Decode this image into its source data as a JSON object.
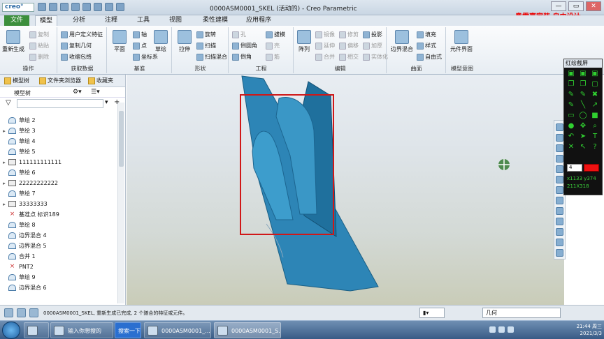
{
  "window": {
    "title": "0000ASM0001_SKEL (活动的) - Creo Parametric",
    "logo": "creo°",
    "controls": [
      "—",
      "▭",
      "✕"
    ],
    "overlay_text": "奥雷嘉家装 自由设计"
  },
  "ribbon_tabs": [
    "文件",
    "模型",
    "分析",
    "注释",
    "工具",
    "视图",
    "柔性建模",
    "应用程序"
  ],
  "ribbon": {
    "groups": {
      "operations": "操作",
      "get_data": "获取数据",
      "datum": "基准",
      "shape": "形状",
      "engineering": "工程",
      "editing": "编辑",
      "surfaces": "曲面",
      "model_intent": "模型意图"
    },
    "operations": {
      "regenerate": "重新生成",
      "copy": "复制",
      "paste": "粘贴",
      "delete": "删除"
    },
    "get_data": {
      "udf": "用户定义特征",
      "copy_geom": "复制几何",
      "shrinkwrap": "收缩包络"
    },
    "datum": {
      "plane": "平面",
      "axis": "轴",
      "point": "点",
      "csys": "坐标系",
      "sketch": "草绘"
    },
    "shape": {
      "extrude": "拉伸",
      "revolve": "旋转",
      "sweep": "扫描",
      "swept_blend": "扫描混合"
    },
    "engineering": {
      "hole": "孔",
      "round": "倒圆角",
      "chamfer": "倒角",
      "draft": "拔模",
      "shell": "壳",
      "rib": "筋"
    },
    "editing": {
      "pattern": "阵列",
      "mirror": "镜像",
      "extend": "延伸",
      "trim": "修剪",
      "offset": "偏移",
      "merge": "合并",
      "intersect": "相交",
      "thicken": "加厚",
      "solidify": "实体化",
      "project": "投影"
    },
    "surfaces": {
      "boundary_blend": "边界混合",
      "fill": "填充",
      "style": "样式",
      "freestyle": "自由式"
    },
    "model_intent": {
      "component_interface": "元件界面"
    }
  },
  "nav": {
    "tabs": [
      "模型树",
      "文件夹浏览器",
      "收藏夹"
    ],
    "tree_header": "模型树",
    "filter_placeholder": "",
    "items": [
      {
        "label": "草绘 2",
        "expandable": false
      },
      {
        "label": "草绘 3",
        "expandable": true
      },
      {
        "label": "草绘 4",
        "expandable": false
      },
      {
        "label": "草绘 5",
        "expandable": false
      },
      {
        "label": "111111111111",
        "expandable": true
      },
      {
        "label": "草绘 6",
        "expandable": false
      },
      {
        "label": "22222222222",
        "expandable": true
      },
      {
        "label": "草绘 7",
        "expandable": false
      },
      {
        "label": "33333333",
        "expandable": true
      },
      {
        "label": "基准点 标识189",
        "expandable": false
      },
      {
        "label": "草绘 8",
        "expandable": false
      },
      {
        "label": "边界混合 4",
        "expandable": false
      },
      {
        "label": "边界混合 5",
        "expandable": false
      },
      {
        "label": "合并 1",
        "expandable": false
      },
      {
        "label": "PNT2",
        "expandable": false
      },
      {
        "label": "草绘 9",
        "expandable": false
      },
      {
        "label": "边界混合 6",
        "expandable": false
      }
    ]
  },
  "palette": {
    "title": "红绘截屏",
    "size_value": "4",
    "coords": "x1133 y374",
    "dims": "211X318"
  },
  "status": {
    "message": "0000ASM0001_SKEL, 重新生成已完成, 2 个随合的特征或元件。",
    "filter_value": "几何"
  },
  "taskbar": {
    "search_placeholder": "输入你想搜的",
    "baidu": "搜索一下",
    "items": [
      "0000ASM0001_...",
      "0000ASM0001_S..."
    ],
    "time": "21:44 周三",
    "date": "2021/3/3"
  },
  "colors": {
    "model": "#2f86b6",
    "model_dark": "#1f6f9a",
    "highlight_box": "#d01818",
    "file_tab": "#3c8f3c"
  }
}
